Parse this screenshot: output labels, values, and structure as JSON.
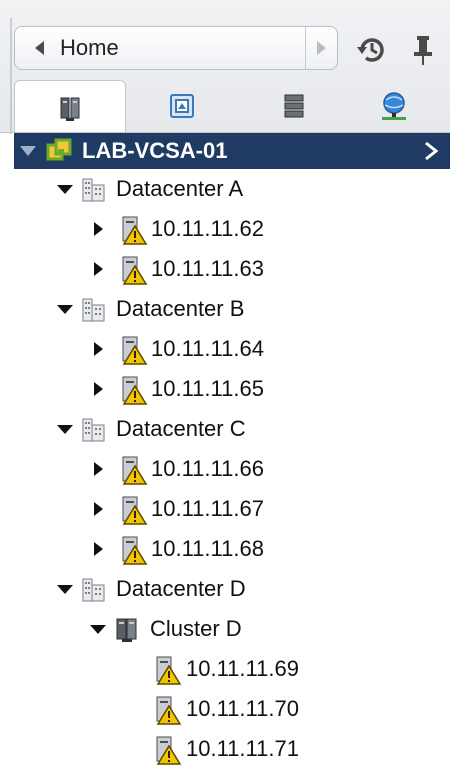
{
  "navigator": {
    "back_label": "Home",
    "history_icon": "history-icon",
    "pin_icon": "pin-icon"
  },
  "tabs": [
    {
      "name": "hosts-and-clusters",
      "icon": "hosts-clusters-icon",
      "active": true
    },
    {
      "name": "vms-and-templates",
      "icon": "vms-templates-icon",
      "active": false
    },
    {
      "name": "storage",
      "icon": "storage-icon",
      "active": false
    },
    {
      "name": "networking",
      "icon": "networking-icon",
      "active": false
    }
  ],
  "tree": {
    "root": {
      "label": "LAB-VCSA-01",
      "icon": "vcenter-icon"
    },
    "datacenters": [
      {
        "label": "Datacenter A",
        "hosts": [
          "10.11.11.62",
          "10.11.11.63"
        ]
      },
      {
        "label": "Datacenter B",
        "hosts": [
          "10.11.11.64",
          "10.11.11.65"
        ]
      },
      {
        "label": "Datacenter C",
        "hosts": [
          "10.11.11.66",
          "10.11.11.67",
          "10.11.11.68"
        ]
      },
      {
        "label": "Datacenter D",
        "cluster": {
          "label": "Cluster D",
          "hosts": [
            "10.11.11.69",
            "10.11.11.70",
            "10.11.11.71"
          ]
        }
      }
    ]
  },
  "colors": {
    "selected_row": "#1f3a63",
    "warning": "#f5c400",
    "vcenter_green": "#6aab2a"
  }
}
